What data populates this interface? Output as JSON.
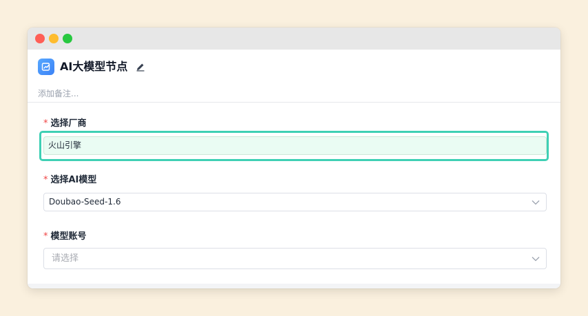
{
  "window": {
    "controls": [
      "close",
      "minimize",
      "maximize"
    ]
  },
  "node": {
    "icon": "chart-edit-icon",
    "title": "AI大模型节点",
    "edit_icon": "pencil-icon",
    "note_placeholder": "添加备注..."
  },
  "form": {
    "required_mark": "*",
    "vendor": {
      "label": "选择厂商",
      "value": "火山引擎"
    },
    "model": {
      "label": "选择AI模型",
      "value": "Doubao-Seed-1.6"
    },
    "account": {
      "label": "模型账号",
      "placeholder": "请选择"
    }
  },
  "colors": {
    "accent_focus": "#3fd0b4",
    "active_field_bg": "#eafcf3",
    "required": "#ef4444",
    "icon_bg": "#3b82f6"
  }
}
